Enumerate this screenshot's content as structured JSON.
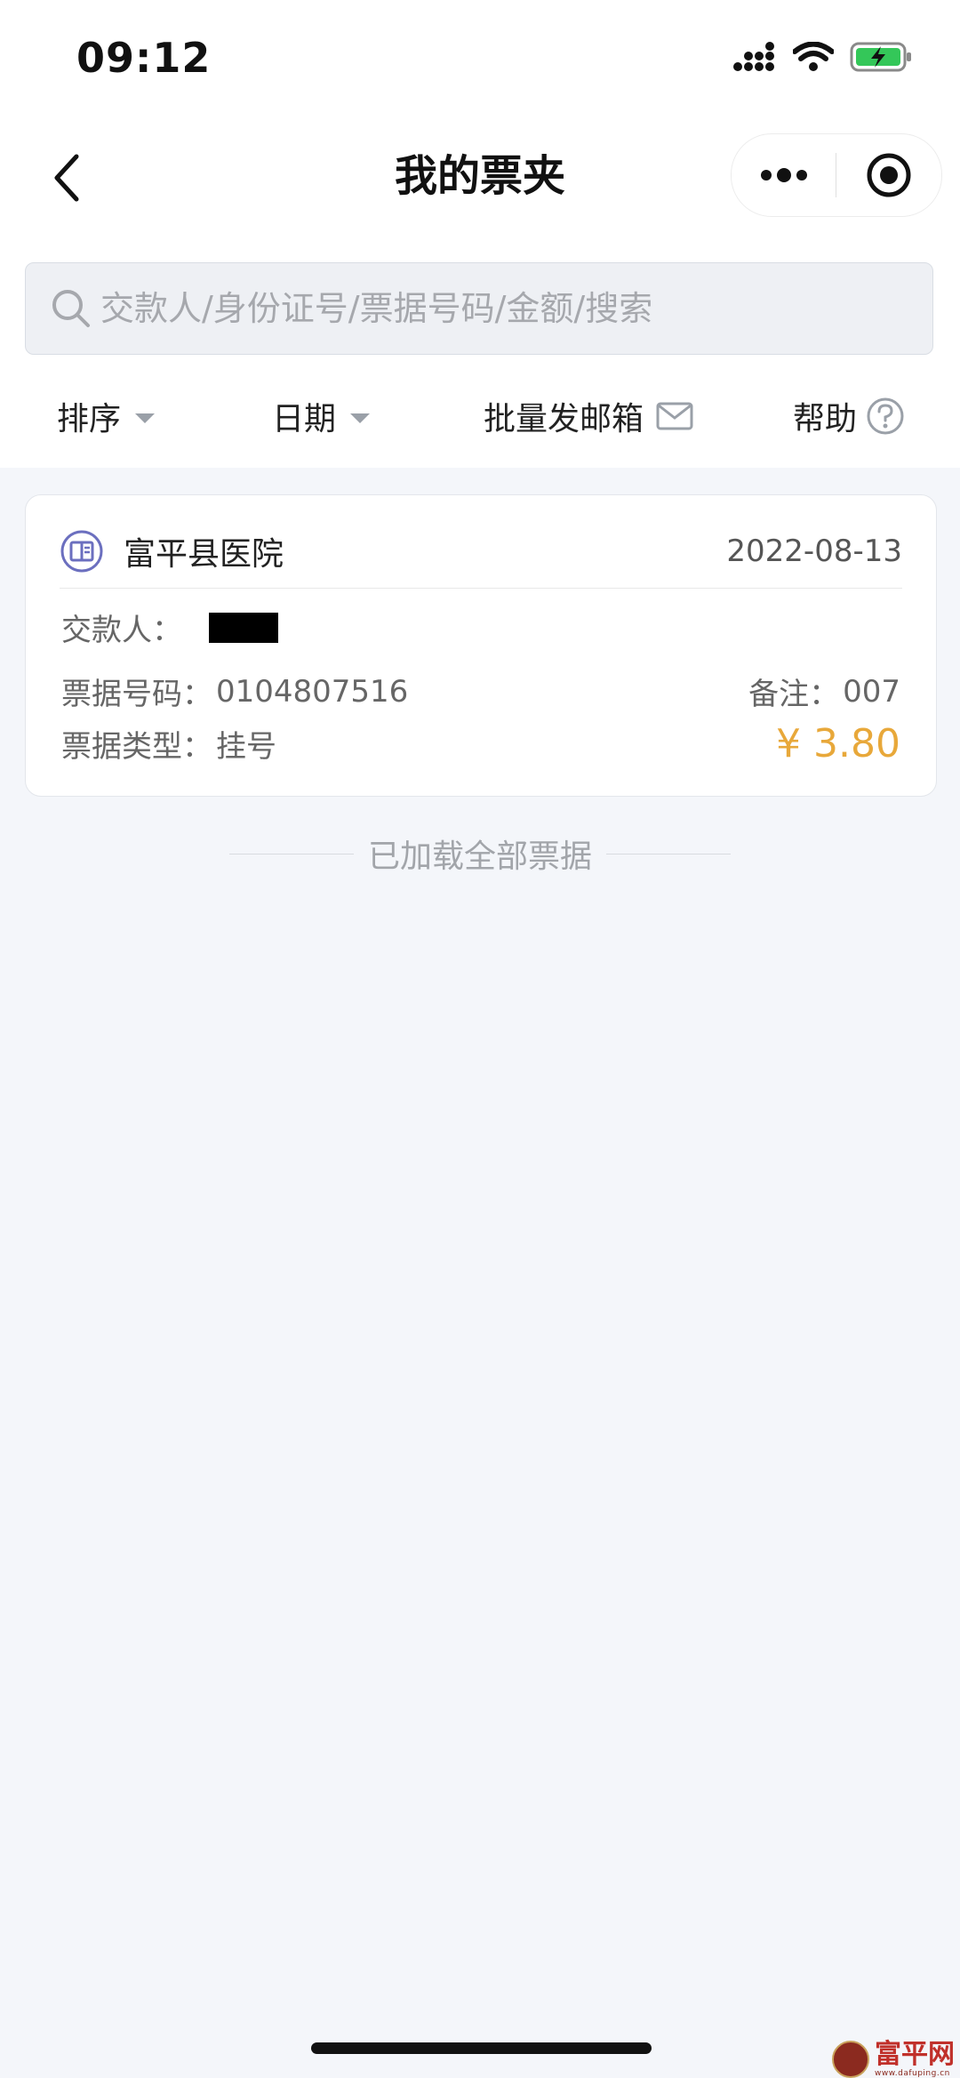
{
  "status_bar": {
    "time": "09:12"
  },
  "nav": {
    "title": "我的票夹"
  },
  "search": {
    "placeholder": "交款人/身份证号/票据号码/金额/搜索"
  },
  "filters": {
    "sort_label": "排序",
    "date_label": "日期",
    "batch_email_label": "批量发邮箱",
    "help_label": "帮助"
  },
  "receipts": [
    {
      "hospital": "富平县医院",
      "date": "2022-08-13",
      "payer_label": "交款人：",
      "number_label": "票据号码：",
      "number": "0104807516",
      "note_label": "备注：",
      "note": "007",
      "type_label": "票据类型：",
      "type": "挂号",
      "amount": "¥ 3.80"
    }
  ],
  "footer_note": "已加载全部票据",
  "watermark": {
    "name": "富平网",
    "sub": "www.dafuping.cn"
  },
  "colors": {
    "amount": "#e8a83a",
    "accent_icon": "#6b6fbf",
    "battery": "#34c759"
  },
  "icons": {
    "back": "chevron-left-icon",
    "more": "more-dots-icon",
    "target": "target-circle-icon",
    "search": "search-icon",
    "mail": "mail-icon",
    "help": "question-circle-icon",
    "hospital": "book-badge-icon"
  }
}
